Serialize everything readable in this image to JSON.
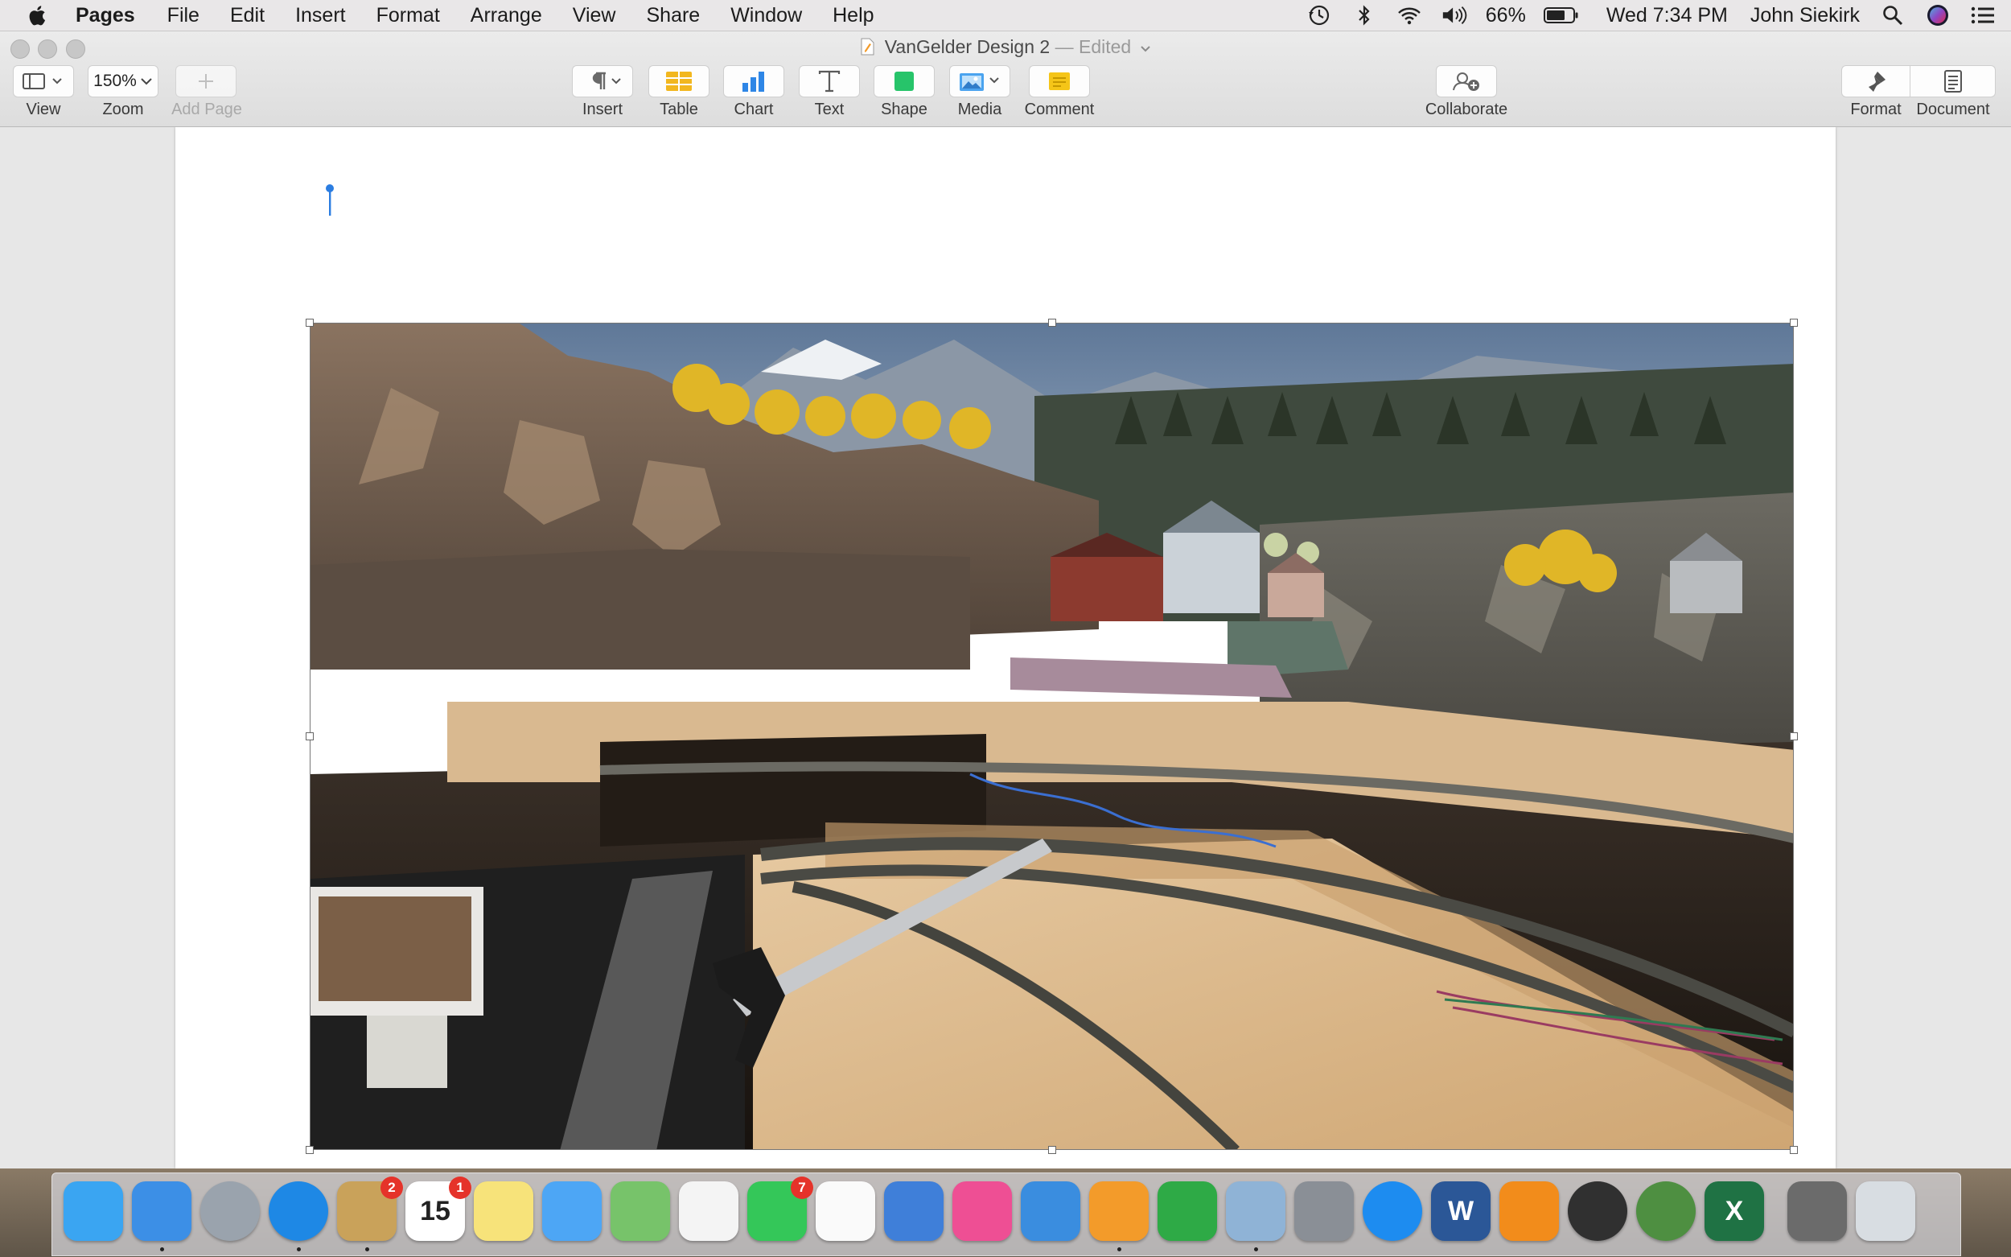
{
  "menubar": {
    "app_name": "Pages",
    "items": [
      "File",
      "Edit",
      "Insert",
      "Format",
      "Arrange",
      "View",
      "Share",
      "Window",
      "Help"
    ],
    "battery_percent": "66%",
    "clock": "Wed 7:34 PM",
    "user": "John Siekirk",
    "status_icons": [
      "time-machine-icon",
      "bluetooth-icon",
      "wifi-icon",
      "volume-icon",
      "battery-icon",
      "search-icon",
      "siri-icon",
      "notification-center-icon"
    ]
  },
  "window": {
    "title": "VanGelder Design 2",
    "title_suffix": "— Edited"
  },
  "toolbar": {
    "view_label": "View",
    "zoom_value": "150%",
    "zoom_label": "Zoom",
    "add_page_label": "Add Page",
    "insert_label": "Insert",
    "table_label": "Table",
    "chart_label": "Chart",
    "text_label": "Text",
    "shape_label": "Shape",
    "media_label": "Media",
    "comment_label": "Comment",
    "collaborate_label": "Collaborate",
    "format_label": "Format",
    "document_label": "Document"
  },
  "colors": {
    "accent": "#2b7de1",
    "table_icon": "#f2b71f",
    "chart_icon": "#2e86e6",
    "shape_icon": "#27c46a",
    "comment_icon": "#f5c518"
  },
  "dock": {
    "apps": [
      {
        "name": "messages-alt",
        "color": "#3aa5f2"
      },
      {
        "name": "finder",
        "color": "#3c8fe6"
      },
      {
        "name": "launchpad",
        "color": "#9aa3ad"
      },
      {
        "name": "safari",
        "color": "#1e88e5"
      },
      {
        "name": "mail-alt",
        "color": "#c9a25a",
        "badge": "2"
      },
      {
        "name": "calendar",
        "color": "#ffffff",
        "badge": "1",
        "text": "15"
      },
      {
        "name": "notes",
        "color": "#f7e37a"
      },
      {
        "name": "messages",
        "color": "#4da6f5"
      },
      {
        "name": "maps",
        "color": "#77c36a"
      },
      {
        "name": "photos",
        "color": "#f4f4f4"
      },
      {
        "name": "facetime",
        "color": "#34c759",
        "badge": "7"
      },
      {
        "name": "reminders",
        "color": "#fafafa"
      },
      {
        "name": "migration",
        "color": "#3f7fd9"
      },
      {
        "name": "itunes",
        "color": "#ee4f94"
      },
      {
        "name": "keynote",
        "color": "#3a8ddf"
      },
      {
        "name": "pages",
        "color": "#f39b2a"
      },
      {
        "name": "numbers",
        "color": "#2eaa46"
      },
      {
        "name": "preview",
        "color": "#8fb3d6"
      },
      {
        "name": "system-preferences",
        "color": "#8a8f96"
      },
      {
        "name": "app-store",
        "color": "#1d8cf0"
      },
      {
        "name": "word",
        "color": "#2b5797",
        "text": "W"
      },
      {
        "name": "books",
        "color": "#f28c1b"
      },
      {
        "name": "photo-booth",
        "color": "#303030"
      },
      {
        "name": "deluxe",
        "color": "#4e8f41"
      },
      {
        "name": "excel",
        "color": "#1f7244",
        "text": "X"
      },
      {
        "name": "image-thumb",
        "color": "#6b6b6b"
      },
      {
        "name": "trash",
        "color": "#d8dde2"
      }
    ]
  }
}
